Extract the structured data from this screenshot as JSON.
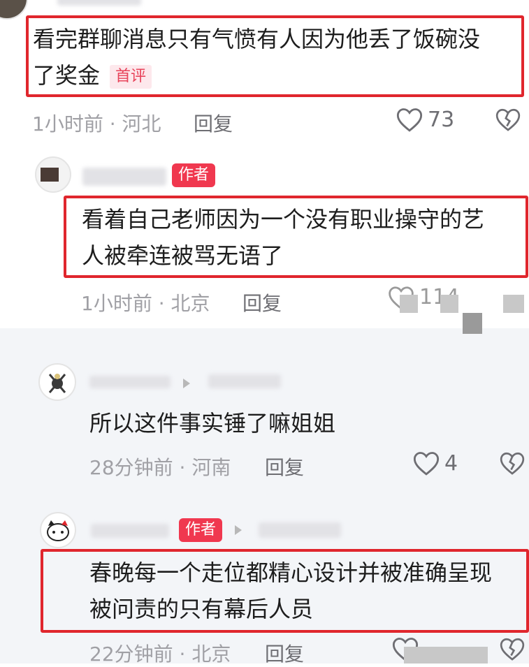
{
  "comments": [
    {
      "text_line1": "看完群聊消息只有气愤有人因为他丢了饭碗没",
      "text_line2": "了奖金",
      "badge": "首评",
      "time": "1小时前",
      "location": "河北",
      "reply_label": "回复",
      "likes": "73"
    },
    {
      "author_badge": "作者",
      "text_line1": "看着自己老师因为一个没有职业操守的艺",
      "text_line2": "人被牵连被骂无语了",
      "time": "1小时前",
      "location": "北京",
      "reply_label": "回复",
      "likes": "114"
    },
    {
      "text_line1": "所以这件事实锤了嘛姐姐",
      "time": "28分钟前",
      "location": "河南",
      "reply_label": "回复",
      "likes": "4"
    },
    {
      "author_badge": "作者",
      "text_line1": "春晚每一个走位都精心设计并被准确呈现",
      "text_line2": "被问责的只有幕后人员",
      "time": "22分钟前",
      "location": "北京",
      "reply_label": "回复"
    }
  ],
  "meta_separator": "·",
  "colors": {
    "highlight_box": "#e0262d",
    "author_badge": "#f0384f",
    "first_comment_tag": "#e8435a"
  },
  "icons": [
    "heart-icon",
    "broken-heart-icon",
    "reply-arrow-icon"
  ]
}
